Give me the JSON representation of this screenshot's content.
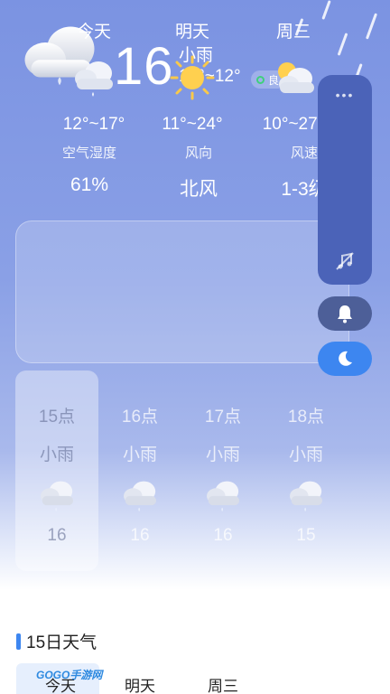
{
  "current": {
    "temperature": "16",
    "condition": "小雨",
    "range": "12°~12°",
    "aqi_label": "良"
  },
  "stats": [
    {
      "label": "空气湿度",
      "value": "61%"
    },
    {
      "label": "风向",
      "value": "北风"
    },
    {
      "label": "风速",
      "value": "1-3级"
    }
  ],
  "forecast": [
    {
      "name": "今天",
      "icon": "cloud-rain-icon",
      "range": "12°~17°"
    },
    {
      "name": "明天",
      "icon": "sun-icon",
      "range": "11°~24°"
    },
    {
      "name": "周三",
      "icon": "partly-cloudy-icon",
      "range": "10°~27°"
    }
  ],
  "hourly": [
    {
      "time": "15点",
      "condition": "小雨",
      "temp": "16"
    },
    {
      "time": "16点",
      "condition": "小雨",
      "temp": "16"
    },
    {
      "time": "17点",
      "condition": "小雨",
      "temp": "16"
    },
    {
      "time": "18点",
      "condition": "小雨",
      "temp": "15"
    }
  ],
  "panel": {
    "menu": "•••"
  },
  "section": {
    "title": "15日天气"
  },
  "tabs": [
    "今天",
    "明天",
    "周三"
  ],
  "watermark": "GOGO手游网",
  "colors": {
    "accent": "#3d86f0",
    "aqi_good": "#3fd07c",
    "panel": "#4b63b8"
  }
}
